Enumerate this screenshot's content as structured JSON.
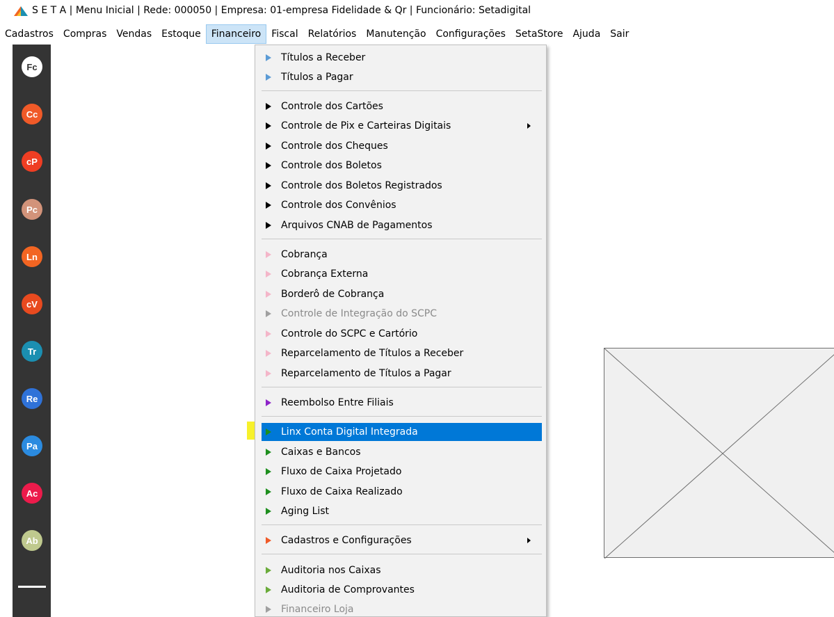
{
  "window": {
    "title": "S E T A | Menu Inicial | Rede: 000050 | Empresa: 01-empresa Fidelidade & Qr | Funcionário: Setadigital"
  },
  "menubar": {
    "items": [
      "Cadastros",
      "Compras",
      "Vendas",
      "Estoque",
      "Financeiro",
      "Fiscal",
      "Relatórios",
      "Manutenção",
      "Configurações",
      "SetaStore",
      "Ajuda",
      "Sair"
    ],
    "active": "Financeiro"
  },
  "sidebar": {
    "buttons": [
      {
        "label": "Fc",
        "color": "#ffffff",
        "text_color": "#333333"
      },
      {
        "label": "Cc",
        "color": "#f05a28"
      },
      {
        "label": "cP",
        "color": "#ef3e23"
      },
      {
        "label": "Pc",
        "color": "#d2937a"
      },
      {
        "label": "Ln",
        "color": "#f26522"
      },
      {
        "label": "cV",
        "color": "#e84a1f"
      },
      {
        "label": "Tr",
        "color": "#1b8fb1"
      },
      {
        "label": "Re",
        "color": "#2f72d8"
      },
      {
        "label": "Pa",
        "color": "#2b8be0"
      },
      {
        "label": "Ac",
        "color": "#ec1b4b"
      },
      {
        "label": "Ab",
        "color": "#bfc98e"
      }
    ]
  },
  "dropdown": {
    "items": [
      {
        "label": "Títulos a Receber",
        "icon": "triangle-right-icon",
        "color": "#5b9bd5"
      },
      {
        "label": "Títulos a Pagar",
        "icon": "triangle-right-icon",
        "color": "#5b9bd5"
      },
      {
        "label": "Controle dos Cartões",
        "icon": "triangle-right-icon",
        "color": "#000000"
      },
      {
        "label": "Controle de Pix e Carteiras Digitais",
        "icon": "triangle-right-icon",
        "color": "#000000",
        "submenu": true
      },
      {
        "label": "Controle dos Cheques",
        "icon": "triangle-right-icon",
        "color": "#000000"
      },
      {
        "label": "Controle dos Boletos",
        "icon": "triangle-right-icon",
        "color": "#000000"
      },
      {
        "label": "Controle dos Boletos Registrados",
        "icon": "triangle-right-icon",
        "color": "#000000"
      },
      {
        "label": "Controle dos Convênios",
        "icon": "triangle-right-icon",
        "color": "#000000"
      },
      {
        "label": "Arquivos CNAB de Pagamentos",
        "icon": "triangle-right-icon",
        "color": "#000000"
      },
      {
        "label": "Cobrança",
        "icon": "triangle-right-icon",
        "color": "#f4b6c9"
      },
      {
        "label": "Cobrança Externa",
        "icon": "triangle-right-icon",
        "color": "#f4b6c9"
      },
      {
        "label": "Borderô de Cobrança",
        "icon": "triangle-right-icon",
        "color": "#f4b6c9"
      },
      {
        "label": "Controle de Integração do SCPC",
        "icon": "triangle-right-icon",
        "color": "#a0a0a0",
        "disabled": true
      },
      {
        "label": "Controle do SCPC e Cartório",
        "icon": "triangle-right-icon",
        "color": "#f4b6c9"
      },
      {
        "label": "Reparcelamento de Títulos a Receber",
        "icon": "triangle-right-icon",
        "color": "#f4b6c9"
      },
      {
        "label": "Reparcelamento de Títulos a Pagar",
        "icon": "triangle-right-icon",
        "color": "#f4b6c9"
      },
      {
        "label": "Reembolso Entre Filiais",
        "icon": "triangle-right-icon",
        "color": "#8e24c9"
      },
      {
        "label": "Linx Conta Digital Integrada",
        "icon": "triangle-right-icon",
        "color": "#1e8f1e",
        "selected": true
      },
      {
        "label": "Caixas e Bancos",
        "icon": "triangle-right-icon",
        "color": "#1e8f1e"
      },
      {
        "label": "Fluxo de Caixa Projetado",
        "icon": "triangle-right-icon",
        "color": "#1e8f1e"
      },
      {
        "label": "Fluxo de Caixa Realizado",
        "icon": "triangle-right-icon",
        "color": "#1e8f1e"
      },
      {
        "label": "Aging List",
        "icon": "triangle-right-icon",
        "color": "#1e8f1e"
      },
      {
        "label": "Cadastros e Configurações",
        "icon": "triangle-right-icon",
        "color": "#f05a28",
        "submenu": true
      },
      {
        "label": "Auditoria nos Caixas",
        "icon": "triangle-right-icon",
        "color": "#6aab3a"
      },
      {
        "label": "Auditoria de Comprovantes",
        "icon": "triangle-right-icon",
        "color": "#6aab3a"
      },
      {
        "label": "Financeiro Loja",
        "icon": "triangle-right-icon",
        "color": "#a0a0a0",
        "disabled": true
      }
    ]
  }
}
